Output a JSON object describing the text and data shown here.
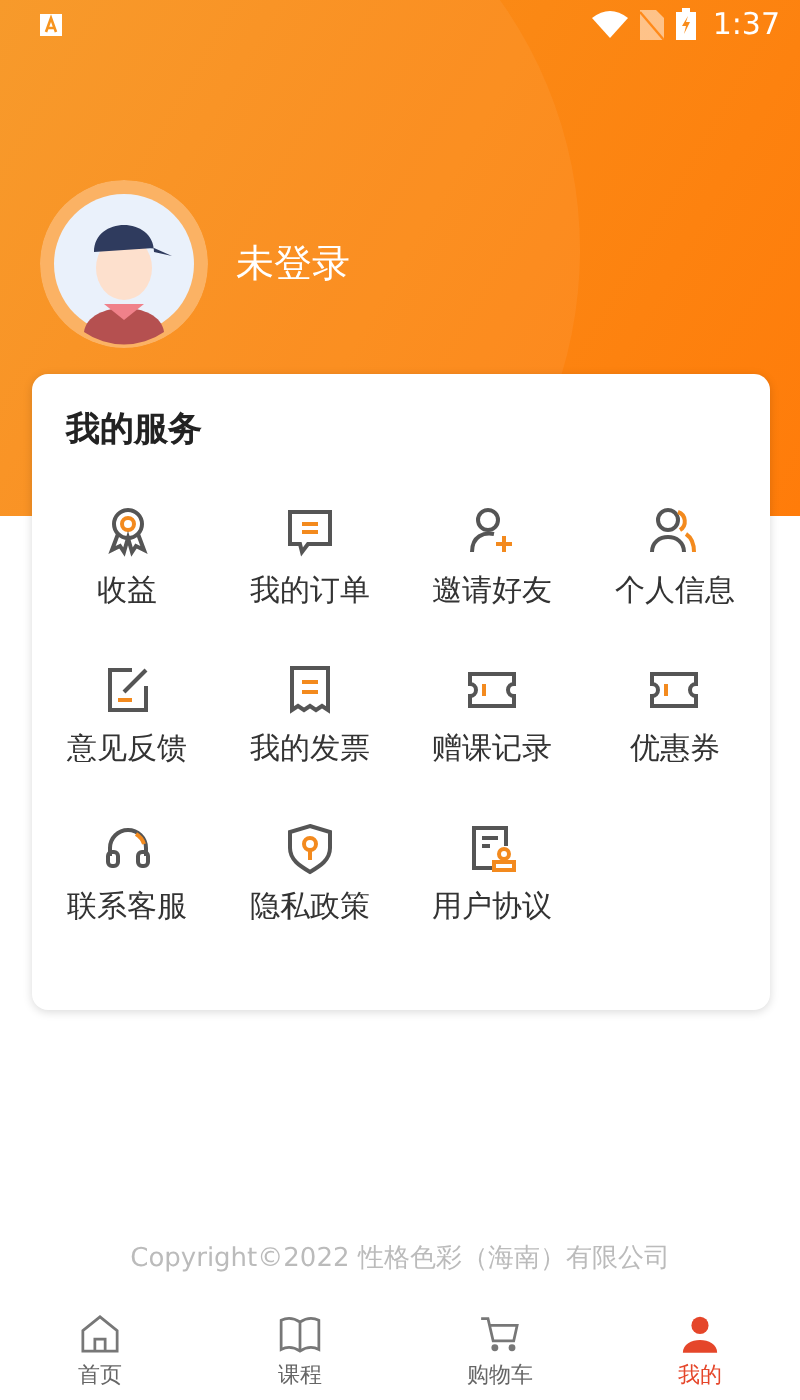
{
  "status_bar": {
    "time": "1:37"
  },
  "profile": {
    "name": "未登录"
  },
  "services": {
    "title": "我的服务",
    "items": [
      {
        "label": "收益",
        "kind": "medal"
      },
      {
        "label": "我的订单",
        "kind": "order"
      },
      {
        "label": "邀请好友",
        "kind": "invite"
      },
      {
        "label": "个人信息",
        "kind": "people"
      },
      {
        "label": "意见反馈",
        "kind": "feedback"
      },
      {
        "label": "我的发票",
        "kind": "invoice"
      },
      {
        "label": "赠课记录",
        "kind": "ticket"
      },
      {
        "label": "优惠券",
        "kind": "ticket"
      },
      {
        "label": "联系客服",
        "kind": "headset"
      },
      {
        "label": "隐私政策",
        "kind": "shield"
      },
      {
        "label": "用户协议",
        "kind": "agreement"
      }
    ]
  },
  "footer": {
    "copyright": "Copyright©2022 性格色彩（海南）有限公司"
  },
  "tabs": [
    {
      "label": "首页",
      "kind": "home",
      "selected": false
    },
    {
      "label": "课程",
      "kind": "book",
      "selected": false
    },
    {
      "label": "购物车",
      "kind": "cart",
      "selected": false
    },
    {
      "label": "我的",
      "kind": "person",
      "selected": true
    }
  ]
}
